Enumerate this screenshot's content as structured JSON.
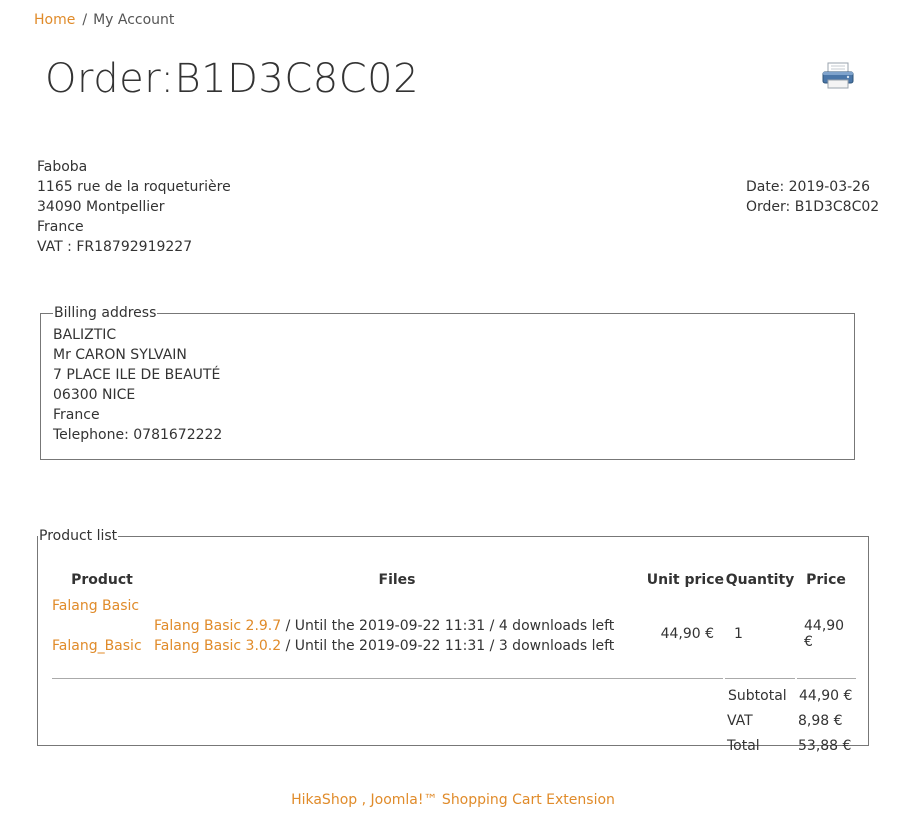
{
  "breadcrumb": {
    "home": "Home",
    "separator": "/",
    "current": "My Account"
  },
  "order_title": "Order:B1D3C8C02",
  "print_icon": "printer-icon",
  "company": {
    "name": "Faboba",
    "street": "1165 rue de la roqueturière",
    "city": "34090 Montpellier",
    "country": "France",
    "vat": "VAT : FR18792919227"
  },
  "meta": {
    "date": "Date: 2019-03-26",
    "order": "Order: B1D3C8C02"
  },
  "billing": {
    "legend": "Billing address",
    "lines": [
      "BALIZTIC",
      "Mr CARON SYLVAIN",
      "7 PLACE ILE DE BEAUTÉ",
      "06300 NICE",
      "France",
      "Telephone: 0781672222"
    ]
  },
  "products": {
    "legend": "Product list",
    "headers": {
      "product": "Product",
      "files": "Files",
      "unit_price": "Unit price",
      "quantity": "Quantity",
      "price": "Price"
    },
    "item": {
      "names": [
        "Falang Basic",
        "Falang_Basic"
      ],
      "files": [
        {
          "link": "Falang Basic 2.9.7",
          "note": " / Until the 2019-09-22 11:31 / 4 downloads left"
        },
        {
          "link": "Falang Basic 3.0.2",
          "note": " / Until the 2019-09-22 11:31 / 3 downloads left"
        }
      ],
      "unit_price": "44,90 €",
      "quantity": "1",
      "price": "44,90 €"
    },
    "totals": {
      "subtotal_label": "Subtotal",
      "subtotal": "44,90 €",
      "vat_label": "VAT",
      "vat": "8,98 €",
      "total_label": "Total",
      "total": "53,88 €"
    }
  },
  "footer": {
    "link": "HikaShop , Joomla!™ Shopping Cart Extension"
  },
  "colors": {
    "accent": "#e08b2a",
    "text": "#333333",
    "border": "#777777"
  }
}
